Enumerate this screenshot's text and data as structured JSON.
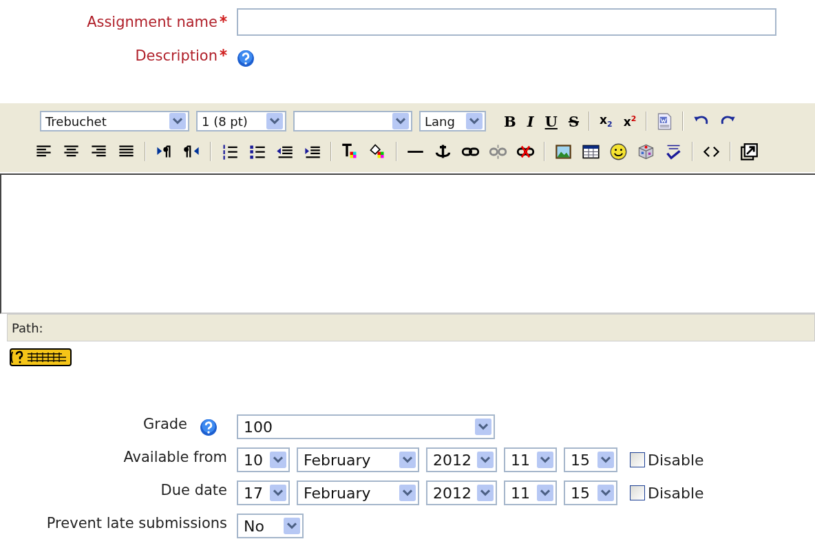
{
  "assignment_name": {
    "label": "Assignment name",
    "required": true
  },
  "description": {
    "label": "Description",
    "required": true,
    "help": true
  },
  "editor": {
    "font": "Trebuchet",
    "size": "1 (8 pt)",
    "lang": "Lang",
    "format_buttons": [
      "B",
      "I",
      "U",
      "S",
      "x$_{2}$",
      "x$^{2}$"
    ],
    "path_label": "Path:"
  },
  "settings": [
    {
      "kind": "select",
      "label": "Grade",
      "help": true,
      "value": "100"
    },
    {
      "kind": "date",
      "label": "Available from",
      "help": false,
      "day": "10",
      "month": "February",
      "year": "2012",
      "hour": "11",
      "minute": "15",
      "disable_label": "Disable",
      "disabled": false
    },
    {
      "kind": "date",
      "label": "Due date",
      "help": false,
      "day": "17",
      "month": "February",
      "year": "2012",
      "hour": "11",
      "minute": "15",
      "disable_label": "Disable",
      "disabled": false
    },
    {
      "kind": "small-select",
      "label": "Prevent late submissions",
      "help": false,
      "value": "No"
    }
  ]
}
